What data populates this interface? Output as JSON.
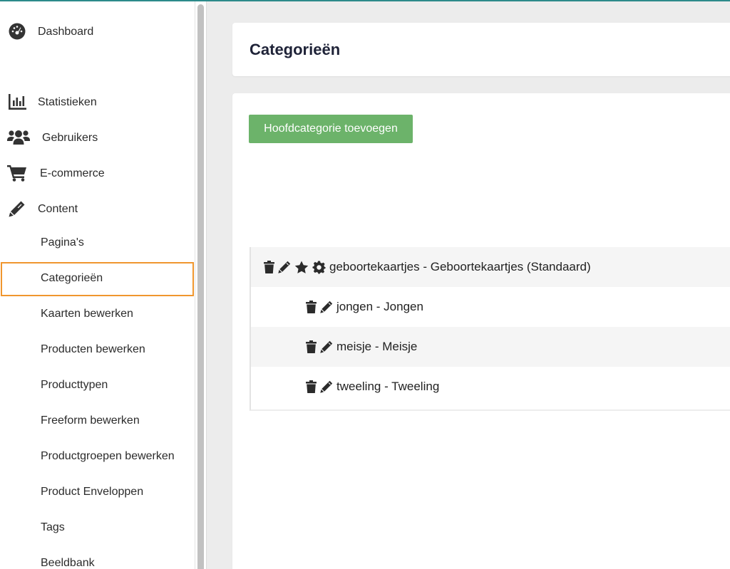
{
  "sidebar": {
    "main_items": [
      {
        "label": "Dashboard",
        "icon": "dashboard-icon"
      },
      {
        "label": "Statistieken",
        "icon": "chart-icon"
      },
      {
        "label": "Gebruikers",
        "icon": "users-icon"
      },
      {
        "label": "E-commerce",
        "icon": "cart-icon"
      },
      {
        "label": "Content",
        "icon": "pencil-icon"
      }
    ],
    "sub_items": [
      {
        "label": "Pagina's"
      },
      {
        "label": "Categorieën",
        "active": true
      },
      {
        "label": "Kaarten bewerken"
      },
      {
        "label": "Producten bewerken"
      },
      {
        "label": "Producttypen"
      },
      {
        "label": "Freeform bewerken"
      },
      {
        "label": "Productgroepen bewerken"
      },
      {
        "label": "Product Enveloppen"
      },
      {
        "label": "Tags"
      },
      {
        "label": "Beeldbank"
      }
    ]
  },
  "page": {
    "title": "Categorieën",
    "add_button_label": "Hoofdcategorie toevoegen"
  },
  "tree": {
    "root": {
      "label": "geboortekaartjes - Geboortekaartjes (Standaard)",
      "actions": [
        "trash-icon",
        "pencil-icon",
        "star-icon",
        "gear-icon"
      ]
    },
    "children": [
      {
        "label": "jongen - Jongen",
        "actions": [
          "trash-icon",
          "pencil-icon"
        ]
      },
      {
        "label": "meisje - Meisje",
        "actions": [
          "trash-icon",
          "pencil-icon"
        ]
      },
      {
        "label": "tweeling - Tweeling",
        "actions": [
          "trash-icon",
          "pencil-icon"
        ]
      }
    ]
  },
  "colors": {
    "accent_teal": "#2c8a8a",
    "active_outline": "#f0962e",
    "button_green": "#6cb36a",
    "title_navy": "#1f2338"
  }
}
